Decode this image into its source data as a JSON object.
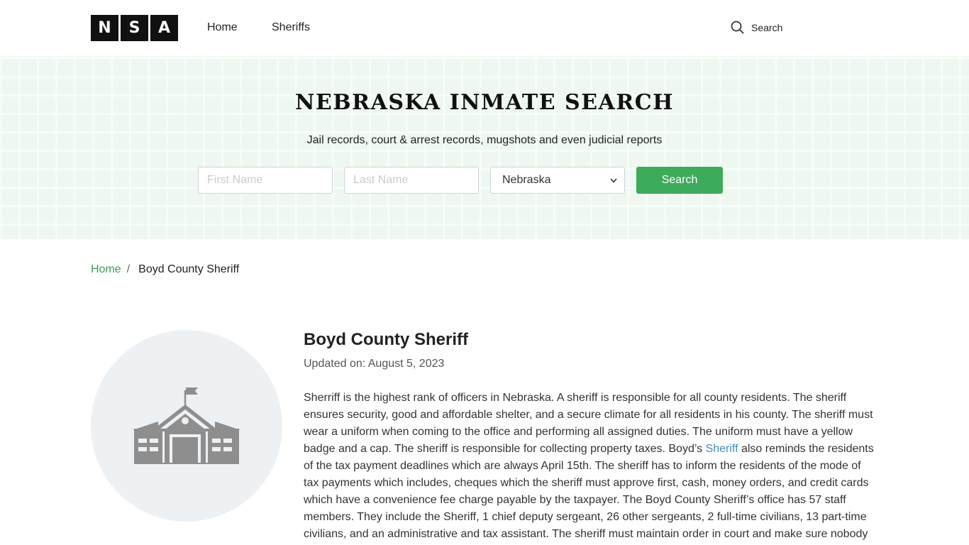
{
  "header": {
    "logo_letters": [
      "N",
      "S",
      "A"
    ],
    "nav": {
      "home": "Home",
      "sheriffs": "Sheriffs"
    },
    "search_label": "Search",
    "search_icon": "search-icon"
  },
  "hero": {
    "title": "NEBRASKA INMATE SEARCH",
    "subtitle": "Jail records, court & arrest records, mugshots and even judicial reports",
    "first_name_placeholder": "First Name",
    "last_name_placeholder": "Last Name",
    "state_value": "Nebraska",
    "search_button": "Search",
    "background_color": "#eef8f1",
    "button_color": "#3dab5c"
  },
  "breadcrumb": {
    "home": "Home",
    "separator": "/",
    "current": "Boyd County Sheriff"
  },
  "article": {
    "image_icon": "building-icon",
    "title": "Boyd County Sheriff",
    "updated": "Updated on: August 5, 2023",
    "body_before_link": "Sherriff is the highest rank of officers in Nebraska. A sheriff is responsible for all county residents. The sheriff ensures security, good and affordable shelter, and a secure climate for all residents in his county. The sheriff must wear a uniform when coming to the office and performing all assigned duties.  The uniform must have a yellow badge and a cap. The sheriff is responsible for collecting property taxes. Boyd’s ",
    "body_link": "Sheriff",
    "body_after_link": " also reminds the residents of the tax payment deadlines which are always April 15th. The sheriff has to inform the residents of the mode of tax payments which includes, cheques which the sheriff must approve first, cash, money orders, and credit cards which have a convenience fee charge payable by the taxpayer.  The Boyd County Sheriff’s office has 57 staff members. They include the Sheriff, 1 chief deputy sergeant, 26 other sergeants, 2 full-time civilians, 13 part-time civilians, and an administrative and tax assistant.  The sheriff must maintain order in court and make sure nobody"
  }
}
